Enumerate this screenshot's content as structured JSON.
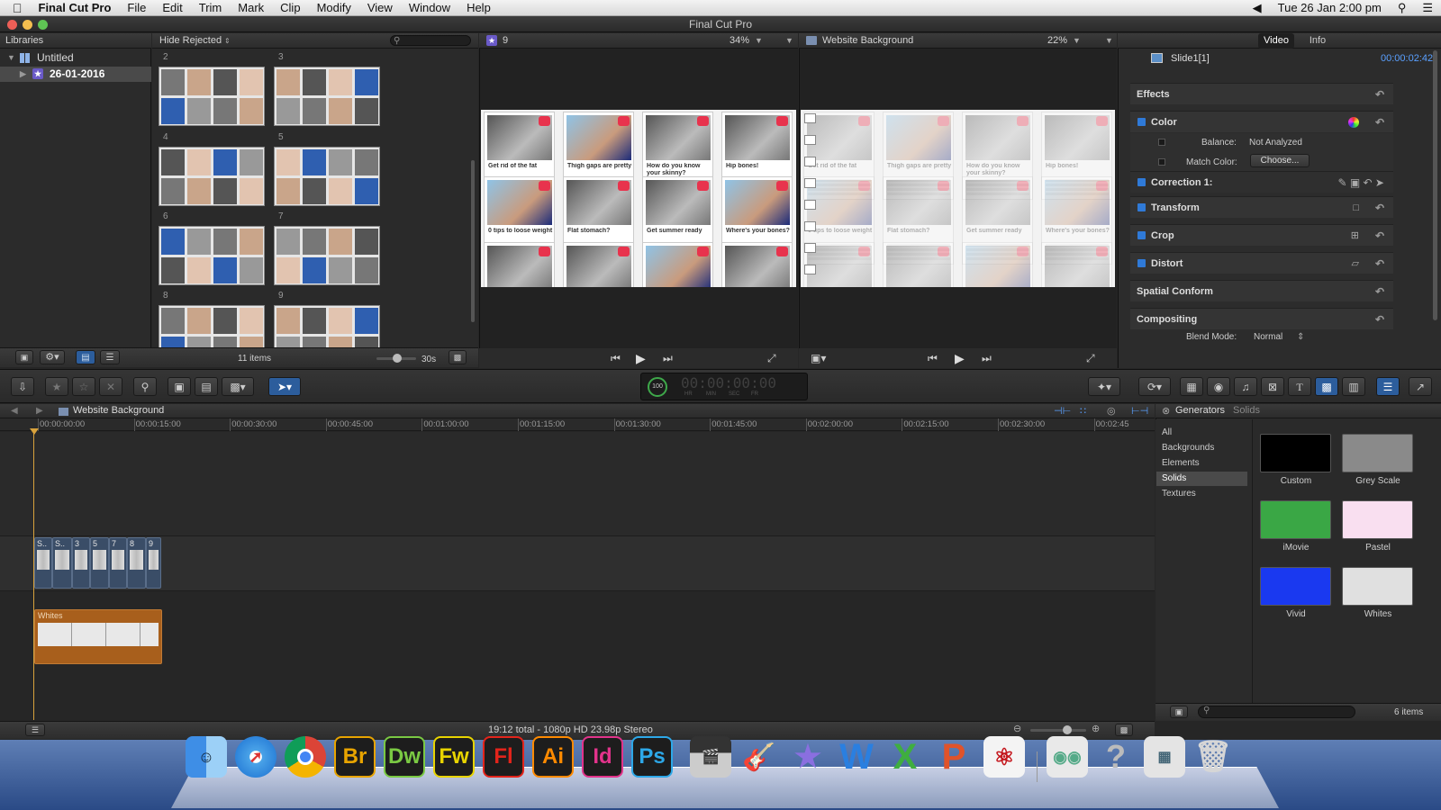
{
  "menubar": {
    "app_name": "Final Cut Pro",
    "items": [
      "File",
      "Edit",
      "Trim",
      "Mark",
      "Clip",
      "Modify",
      "View",
      "Window",
      "Help"
    ],
    "clock": "Tue 26 Jan  2:00 pm"
  },
  "window": {
    "title": "Final Cut Pro"
  },
  "libraries": {
    "header": "Libraries",
    "library_name": "Untitled",
    "event_name": "26-01-2016"
  },
  "browser": {
    "filter_label": "Hide Rejected",
    "thumb_numbers": [
      "2",
      "3",
      "4",
      "5",
      "6",
      "7",
      "8",
      "9"
    ],
    "items_count": "11 items",
    "duration_label": "30s"
  },
  "viewer_event": {
    "title": "9",
    "zoom": "34%"
  },
  "viewer_main": {
    "title": "Website Background",
    "zoom": "22%"
  },
  "viewer_captions": [
    "Get rid of the fat",
    "Thigh gaps are pretty",
    "How do you know your skinny?",
    "Hip bones!",
    "0 tips to loose weight",
    "Flat stomach?",
    "Get summer ready",
    "Where's your bones?"
  ],
  "inspector": {
    "tabs": [
      "Video",
      "Info"
    ],
    "clip_name": "Slide1[1]",
    "timecode": "00:00:02:42",
    "effects": "Effects",
    "color": "Color",
    "balance_label": "Balance:",
    "balance_value": "Not Analyzed",
    "match_color_label": "Match Color:",
    "match_color_button": "Choose...",
    "correction": "Correction 1:",
    "transform": "Transform",
    "crop": "Crop",
    "distort": "Distort",
    "spatial_conform": "Spatial Conform",
    "compositing": "Compositing",
    "blend_mode_label": "Blend Mode:",
    "blend_mode_value": "Normal"
  },
  "timeline": {
    "project_name": "Website Background",
    "ruler": [
      "00:00:00:00",
      "00:00:15:00",
      "00:00:30:00",
      "00:00:45:00",
      "00:01:00:00",
      "00:01:15:00",
      "00:01:30:00",
      "00:01:45:00",
      "00:02:00:00",
      "00:02:15:00",
      "00:02:30:00",
      "00:02:45"
    ],
    "clips": [
      "S..",
      "S..",
      "3",
      "5",
      "7",
      "8",
      "9"
    ],
    "whites_clip": "Whites",
    "status": "19:12 total - 1080p HD 23.98p Stereo"
  },
  "dashboard": {
    "value": "100",
    "units": [
      "HR",
      "MIN",
      "SEC",
      "FR"
    ]
  },
  "generators": {
    "header": "Generators",
    "crumb": "Solids",
    "categories": [
      "All",
      "Backgrounds",
      "Elements",
      "Solids",
      "Textures"
    ],
    "selected_category": "Solids",
    "items": [
      {
        "name": "Custom",
        "color": "#000000"
      },
      {
        "name": "Grey Scale",
        "color": "#8a8a8a"
      },
      {
        "name": "iMovie",
        "color": "#3aa745"
      },
      {
        "name": "Pastel",
        "color": "#f9dff0"
      },
      {
        "name": "Vivid",
        "color": "#1a39f0"
      },
      {
        "name": "Whites",
        "color": "#e0e0e0"
      }
    ],
    "count": "6 items"
  },
  "dock": {
    "adobe": [
      {
        "label": "Br",
        "color": "#e8a400"
      },
      {
        "label": "Dw",
        "color": "#7ac943"
      },
      {
        "label": "Fw",
        "color": "#e8d400"
      },
      {
        "label": "Fl",
        "color": "#e3241b"
      },
      {
        "label": "Ai",
        "color": "#ff8a00"
      },
      {
        "label": "Id",
        "color": "#e2338b"
      },
      {
        "label": "Ps",
        "color": "#2da8e8"
      }
    ]
  }
}
